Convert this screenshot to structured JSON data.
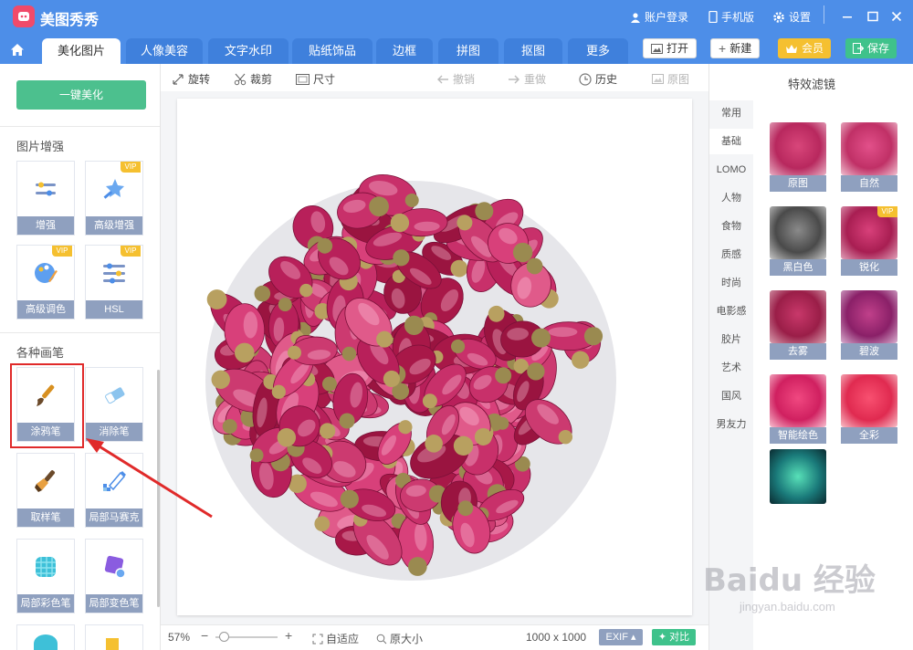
{
  "app": {
    "title": "美图秀秀"
  },
  "titlebar": {
    "login": "账户登录",
    "mobile": "手机版",
    "settings": "设置"
  },
  "tabs": [
    "美化图片",
    "人像美容",
    "文字水印",
    "贴纸饰品",
    "边框",
    "拼图",
    "抠图",
    "更多"
  ],
  "header_buttons": {
    "open": "打开",
    "new": "新建",
    "member": "会员",
    "save": "保存"
  },
  "left": {
    "one_key": "一键美化",
    "enhance_title": "图片增强",
    "enhance_tools": [
      {
        "label": "增强",
        "vip": false
      },
      {
        "label": "高级增强",
        "vip": true
      },
      {
        "label": "高级调色",
        "vip": true
      },
      {
        "label": "HSL",
        "vip": false
      }
    ],
    "brush_title": "各种画笔",
    "brush_tools": [
      {
        "label": "涂鸦笔"
      },
      {
        "label": "消除笔"
      },
      {
        "label": "取样笔"
      },
      {
        "label": "局部马赛克"
      },
      {
        "label": "局部彩色笔"
      },
      {
        "label": "局部变色笔"
      }
    ],
    "vip_badge": "VIP"
  },
  "toolbar": {
    "rotate": "旋转",
    "crop": "裁剪",
    "size": "尺寸",
    "undo": "撤销",
    "redo": "重做",
    "history": "历史",
    "original": "原图"
  },
  "statusbar": {
    "zoom": "57%",
    "fit": "自适应",
    "actual": "原大小",
    "dimensions": "1000 x 1000",
    "exif": "EXIF",
    "compare": "对比"
  },
  "right": {
    "title": "特效滤镜",
    "categories": [
      "常用",
      "基础",
      "LOMO",
      "人物",
      "食物",
      "质感",
      "时尚",
      "电影感",
      "胶片",
      "艺术",
      "国风",
      "男友力"
    ],
    "active_category": "基础",
    "filters": [
      {
        "label": "原图",
        "vip": false
      },
      {
        "label": "自然",
        "vip": false
      },
      {
        "label": "黑白色",
        "vip": false
      },
      {
        "label": "锐化",
        "vip": true
      },
      {
        "label": "去雾",
        "vip": false
      },
      {
        "label": "碧波",
        "vip": false
      },
      {
        "label": "智能绘色",
        "vip": false
      },
      {
        "label": "全彩",
        "vip": false
      }
    ]
  },
  "watermark": {
    "main": "Baidu 经验",
    "sub": "jingyan.baidu.com"
  },
  "colors": {
    "brand_blue": "#4d8ee8",
    "green": "#3fc28b",
    "gold": "#f5c030",
    "label_gray": "#8fa0bf",
    "highlight_red": "#e02a2a"
  }
}
